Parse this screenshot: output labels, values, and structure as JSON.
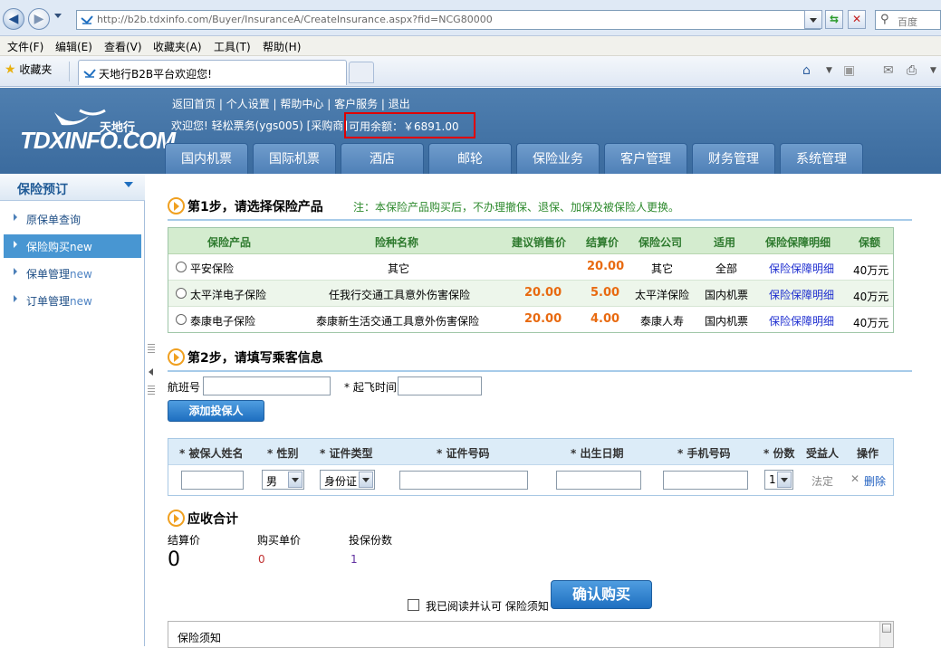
{
  "browser": {
    "url": "http://b2b.tdxinfo.com/Buyer/InsuranceA/CreateInsurance.aspx?fid=NCG80000",
    "search_placeholder": "百度",
    "menu": [
      "文件(F)",
      "编辑(E)",
      "查看(V)",
      "收藏夹(A)",
      "工具(T)",
      "帮助(H)"
    ],
    "favorites": "收藏夹",
    "tab_title": "天地行B2B平台欢迎您!"
  },
  "header": {
    "logo_text": "TDXINFO.COM",
    "logo_cn": "天地行",
    "toplinks": [
      "返回首页",
      "个人设置",
      "帮助中心",
      "客户服务",
      "退出"
    ],
    "welcome": "欢迎您! 轻松票务(ygs005) [采购商]",
    "balance": "可用余额：￥6891.00",
    "nav": [
      "国内机票",
      "国际机票",
      "酒店",
      "邮轮",
      "保险业务",
      "客户管理",
      "财务管理",
      "系统管理"
    ]
  },
  "sidebar": {
    "title": "保险预订",
    "items": [
      {
        "label": "原保单查询",
        "suffix": ""
      },
      {
        "label": "保险购买",
        "suffix": "new"
      },
      {
        "label": "保单管理",
        "suffix": "new"
      },
      {
        "label": "订单管理",
        "suffix": "new"
      }
    ]
  },
  "step1": {
    "title": "第1步，请选择保险产品",
    "note": "注：本保险产品购买后，不办理撤保、退保、加保及被保险人更换。",
    "headers": [
      "保险产品",
      "险种名称",
      "建议销售价",
      "结算价",
      "保险公司",
      "适用",
      "保险保障明细",
      "保额"
    ],
    "rows": [
      {
        "product": "平安保险",
        "name": "其它",
        "suggested": "",
        "settle": "20.00",
        "company": "其它",
        "scope": "全部",
        "detail": "保险保障明细",
        "amount": "40万元"
      },
      {
        "product": "太平洋电子保险",
        "name": "任我行交通工具意外伤害保险",
        "suggested": "20.00",
        "settle": "5.00",
        "company": "太平洋保险",
        "scope": "国内机票",
        "detail": "保险保障明细",
        "amount": "40万元"
      },
      {
        "product": "泰康电子保险",
        "name": "泰康新生活交通工具意外伤害保险",
        "suggested": "20.00",
        "settle": "4.00",
        "company": "泰康人寿",
        "scope": "国内机票",
        "detail": "保险保障明细",
        "amount": "40万元"
      }
    ]
  },
  "step2": {
    "title": "第2步，请填写乘客信息",
    "flight_label": "航班号",
    "departure_label": "* 起飞时间",
    "add_button": "添加投保人",
    "headers": [
      "* 被保人姓名",
      "* 性别",
      "* 证件类型",
      "* 证件号码",
      "* 出生日期",
      "* 手机号码",
      "* 份数",
      "受益人",
      "操作"
    ],
    "row": {
      "gender": "男",
      "id_type": "身份证",
      "copies": "1",
      "beneficiary": "法定",
      "delete": "删除"
    }
  },
  "summary": {
    "title": "应收合计",
    "settle_label": "结算价",
    "settle_value": "0",
    "unit_label": "购买单价",
    "unit_value": "0",
    "copies_label": "投保份数",
    "copies_value": "1",
    "agree_label": "我已阅读并认可 保险须知",
    "confirm_button": "确认购买",
    "notice_title": "保险须知"
  },
  "colors": {
    "header_blue": "#4a7aac",
    "accent_orange": "#e86a10",
    "highlight_red": "#e00000",
    "sidebar_active": "#4896d2"
  }
}
